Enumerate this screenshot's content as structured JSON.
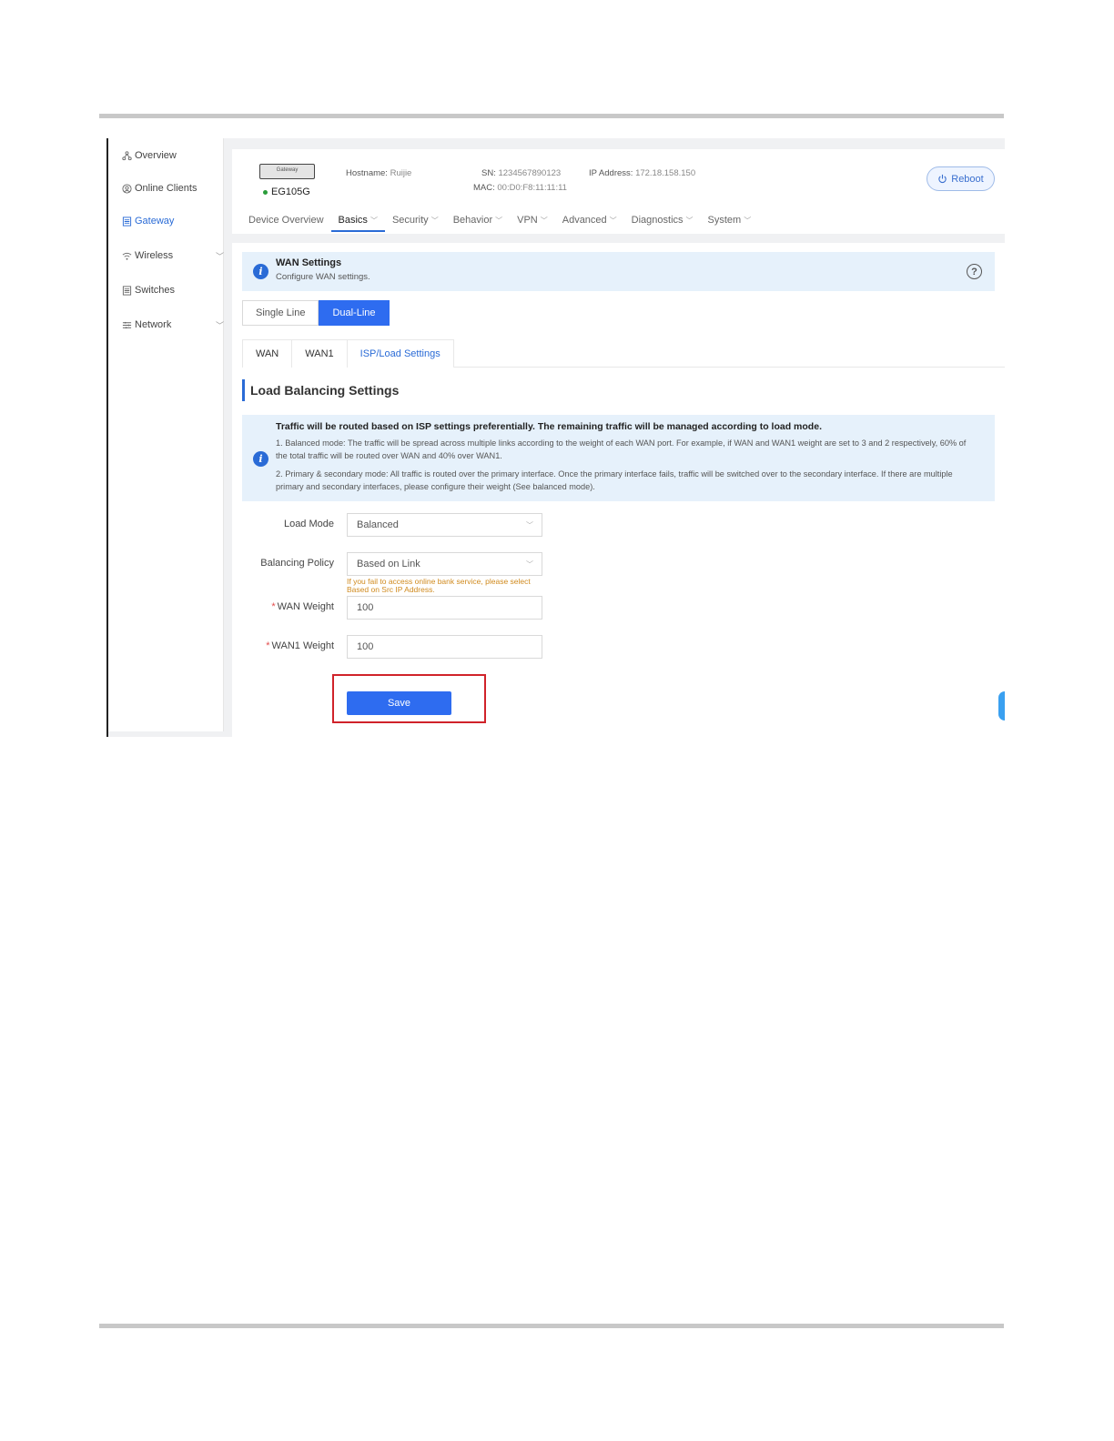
{
  "sidebar": {
    "items": [
      {
        "label": "Overview",
        "icon": "overview-icon"
      },
      {
        "label": "Online Clients",
        "icon": "clients-icon"
      },
      {
        "label": "Gateway",
        "icon": "gateway-icon",
        "active": true
      },
      {
        "label": "Wireless",
        "icon": "wifi-icon",
        "expandable": true
      },
      {
        "label": "Switches",
        "icon": "switch-icon"
      },
      {
        "label": "Network",
        "icon": "network-icon",
        "expandable": true
      }
    ]
  },
  "device": {
    "image_label": "Gateway",
    "model": "EG105G",
    "hostname_label": "Hostname:",
    "hostname": "Ruijie",
    "sn_label": "SN:",
    "sn": "1234567890123",
    "ip_label": "IP Address:",
    "ip": "172.18.158.150",
    "mac_label": "MAC:",
    "mac": "00:D0:F8:11:11:11",
    "reboot_label": "Reboot",
    "status_color": "#2a9d3a"
  },
  "tabs": [
    {
      "label": "Device Overview",
      "dropdown": false
    },
    {
      "label": "Basics",
      "dropdown": true,
      "active": true
    },
    {
      "label": "Security",
      "dropdown": true
    },
    {
      "label": "Behavior",
      "dropdown": true
    },
    {
      "label": "VPN",
      "dropdown": true
    },
    {
      "label": "Advanced",
      "dropdown": true
    },
    {
      "label": "Diagnostics",
      "dropdown": true
    },
    {
      "label": "System",
      "dropdown": true
    }
  ],
  "wan_banner": {
    "title": "WAN Settings",
    "subtitle": "Configure WAN settings."
  },
  "line_mode": {
    "single": "Single Line",
    "dual": "Dual-Line",
    "selected": "Dual-Line"
  },
  "subtabs": {
    "wan": "WAN",
    "wan1": "WAN1",
    "isp": "ISP/Load Settings",
    "selected": "ISP/Load Settings"
  },
  "section_title": "Load Balancing Settings",
  "lb_banner": {
    "line1": "Traffic will be routed based on ISP settings preferentially. The remaining traffic will be managed according to load mode.",
    "line2": "1. Balanced mode: The traffic will be spread across multiple links according to the weight of each WAN port. For example, if WAN and WAN1 weight are set to 3 and 2 respectively, 60% of the total traffic will be routed over WAN and 40% over WAN1.",
    "line3": "2. Primary & secondary mode: All traffic is routed over the primary interface. Once the primary interface fails, traffic will be switched over to the secondary interface. If there are multiple primary and secondary interfaces, please configure their weight (See balanced mode)."
  },
  "form": {
    "load_mode_label": "Load Mode",
    "load_mode_value": "Balanced",
    "balancing_policy_label": "Balancing Policy",
    "balancing_policy_value": "Based on Link",
    "balancing_hint": "If you fail to access online bank service, please select Based on Src IP Address.",
    "required_mark": "*",
    "wan_weight_label": "WAN Weight",
    "wan_weight_value": "100",
    "wan1_weight_label": "WAN1 Weight",
    "wan1_weight_value": "100",
    "save_label": "Save"
  },
  "colors": {
    "accent": "#2e6cf0",
    "highlight_box": "#d0232a",
    "banner_bg": "#e6f1fb",
    "hint": "#d08a1e"
  }
}
